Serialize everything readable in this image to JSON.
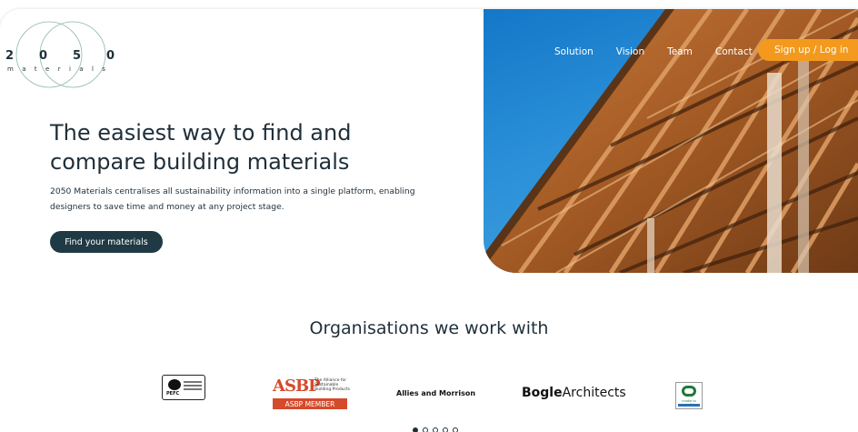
{
  "logo": {
    "digits": [
      "2",
      "0",
      "5",
      "0"
    ],
    "word": [
      "m",
      "a",
      "t",
      "e",
      "r",
      "i",
      "a",
      "l",
      "s"
    ]
  },
  "nav": {
    "links": [
      "Solution",
      "Vision",
      "Team",
      "Contact"
    ],
    "cta": "Sign up / Log in"
  },
  "hero": {
    "title_line1": "The easiest way to find and",
    "title_line2": "compare building materials",
    "description_line1": "2050 Materials centralises all sustainability information into a single platform, enabling",
    "description_line2": "designers to save time and money at any project stage.",
    "cta": "Find your materials"
  },
  "orgs": {
    "title": "Organisations we work with",
    "pefc": "PEFC",
    "asbp_mark": "ASBP",
    "asbp_tagline": "The Alliance for Sustainable Building Products",
    "asbp_member": "ASBP MEMBER",
    "allies": "Allies and Morrison",
    "bogle_bold": "Bogle",
    "bogle_rest": " Architects",
    "c2c_sub": "cradle to cradle"
  },
  "carousel": {
    "count": 5,
    "active": 0
  },
  "colors": {
    "accent": "#f39a1e",
    "primary_dark": "#1f3a44",
    "text": "#1f2f3a",
    "asbp_red": "#d64a2c"
  }
}
